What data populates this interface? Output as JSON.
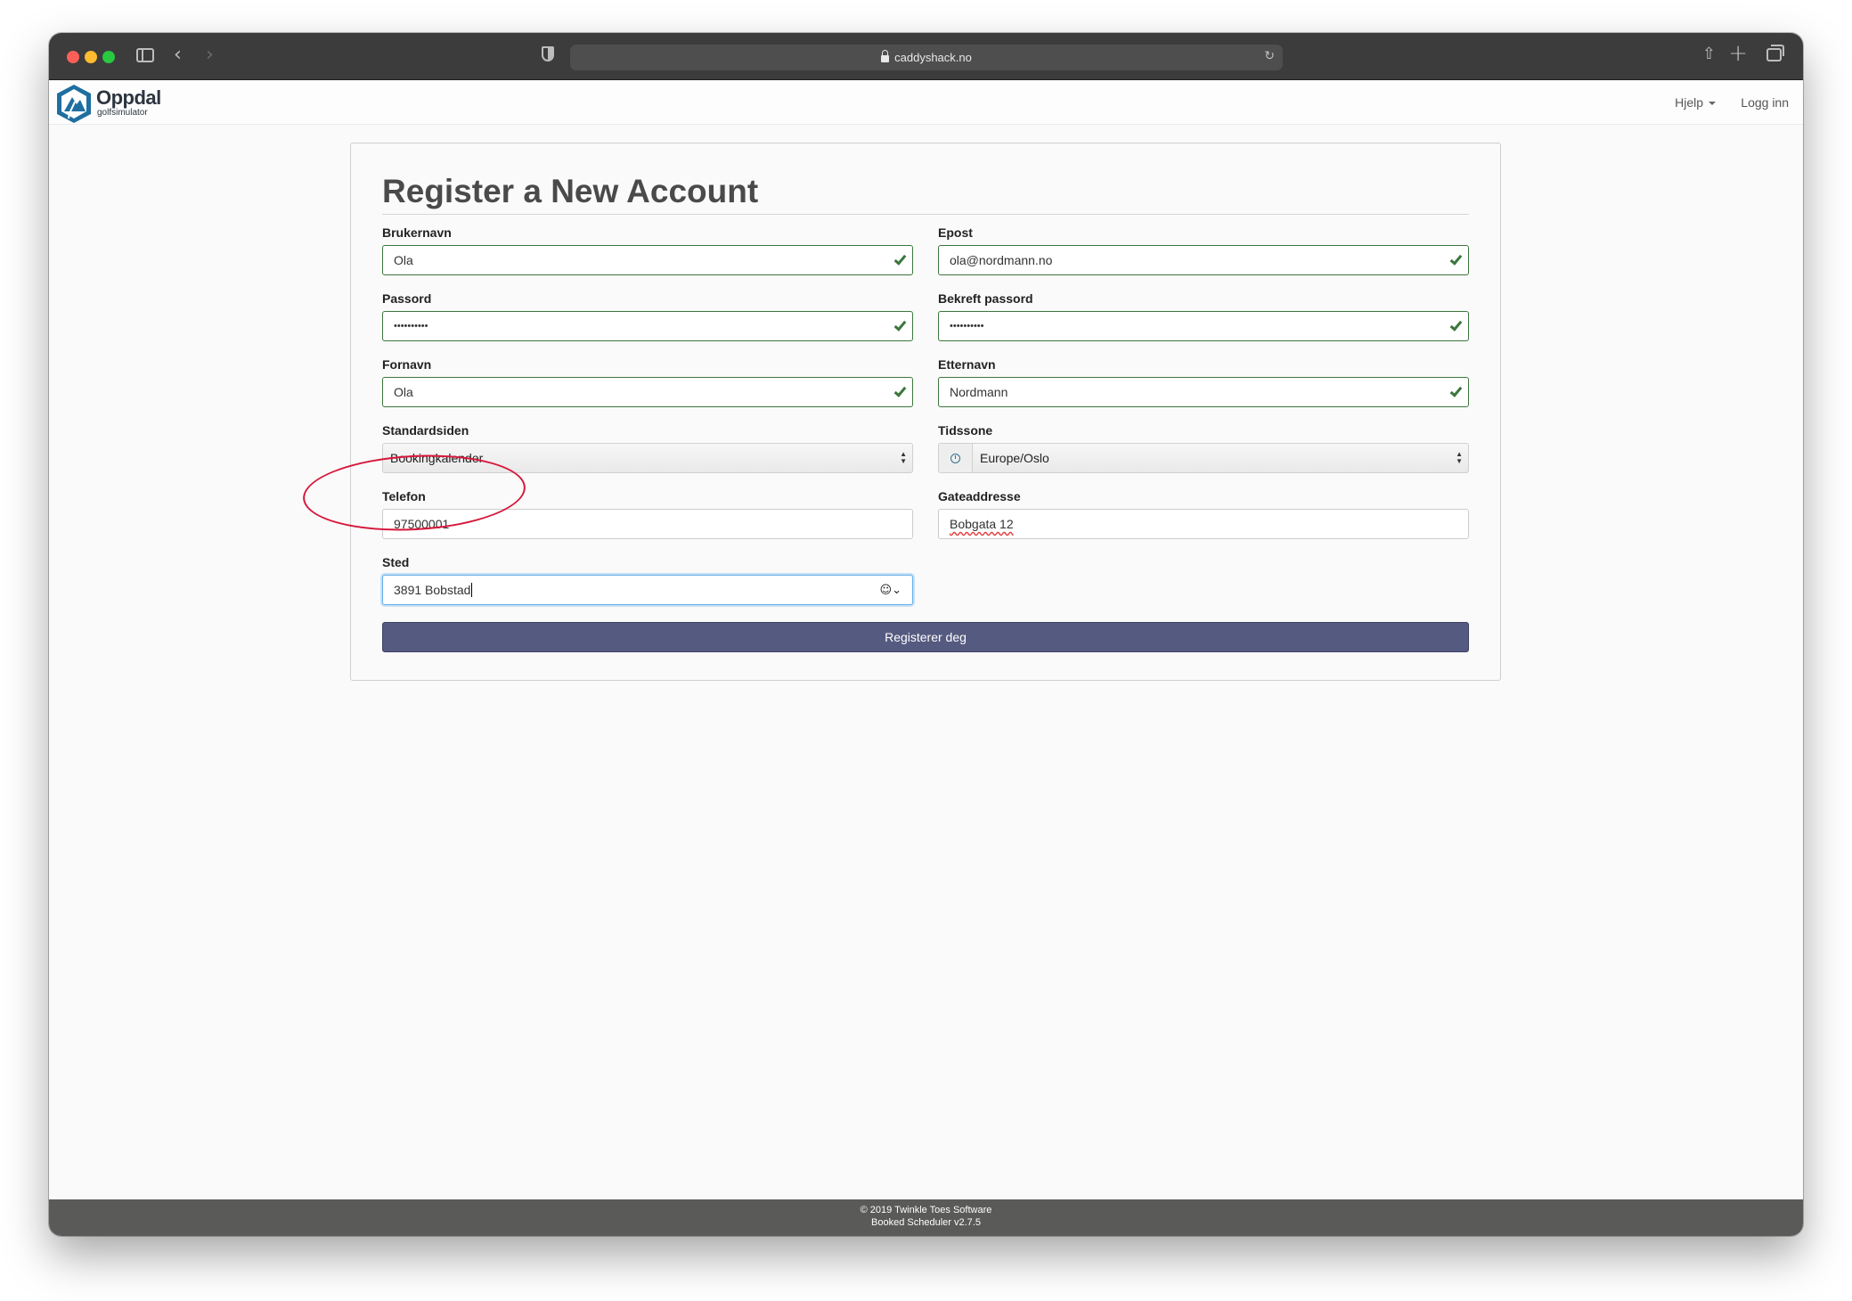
{
  "browser": {
    "url": "caddyshack.no"
  },
  "navbar": {
    "logo_title": "Oppdal",
    "logo_subtitle": "golfsimulator",
    "help_label": "Hjelp",
    "login_label": "Logg inn"
  },
  "form": {
    "title": "Register a New Account",
    "username": {
      "label": "Brukernavn",
      "value": "Ola"
    },
    "email": {
      "label": "Epost",
      "value": "ola@nordmann.no"
    },
    "password": {
      "label": "Passord",
      "value": "••••••••••"
    },
    "confirm_password": {
      "label": "Bekreft passord",
      "value": "••••••••••"
    },
    "first_name": {
      "label": "Fornavn",
      "value": "Ola"
    },
    "last_name": {
      "label": "Etternavn",
      "value": "Nordmann"
    },
    "default_page": {
      "label": "Standardsiden",
      "value": "Bookingkalender"
    },
    "timezone": {
      "label": "Tidssone",
      "value": "Europe/Oslo"
    },
    "phone": {
      "label": "Telefon",
      "value": "97500001"
    },
    "street": {
      "label": "Gateaddresse",
      "value": "Bobgata 12"
    },
    "place": {
      "label": "Sted",
      "value": "3891 Bobstad"
    },
    "submit_label": "Registerer deg"
  },
  "footer": {
    "copyright": "© 2019 Twinkle Toes Software",
    "version": "Booked Scheduler v2.7.5"
  },
  "colors": {
    "valid_border": "#3c763d",
    "submit_bg": "#555a80",
    "annotation": "#d6163a",
    "footer_bg": "#5a5a58"
  },
  "icons": [
    "sidebar-icon",
    "back-icon",
    "forward-icon",
    "shield-icon",
    "lock-icon",
    "reload-icon",
    "share-icon",
    "plus-icon",
    "tabs-icon",
    "check-icon",
    "clock-icon",
    "contact-icon"
  ]
}
